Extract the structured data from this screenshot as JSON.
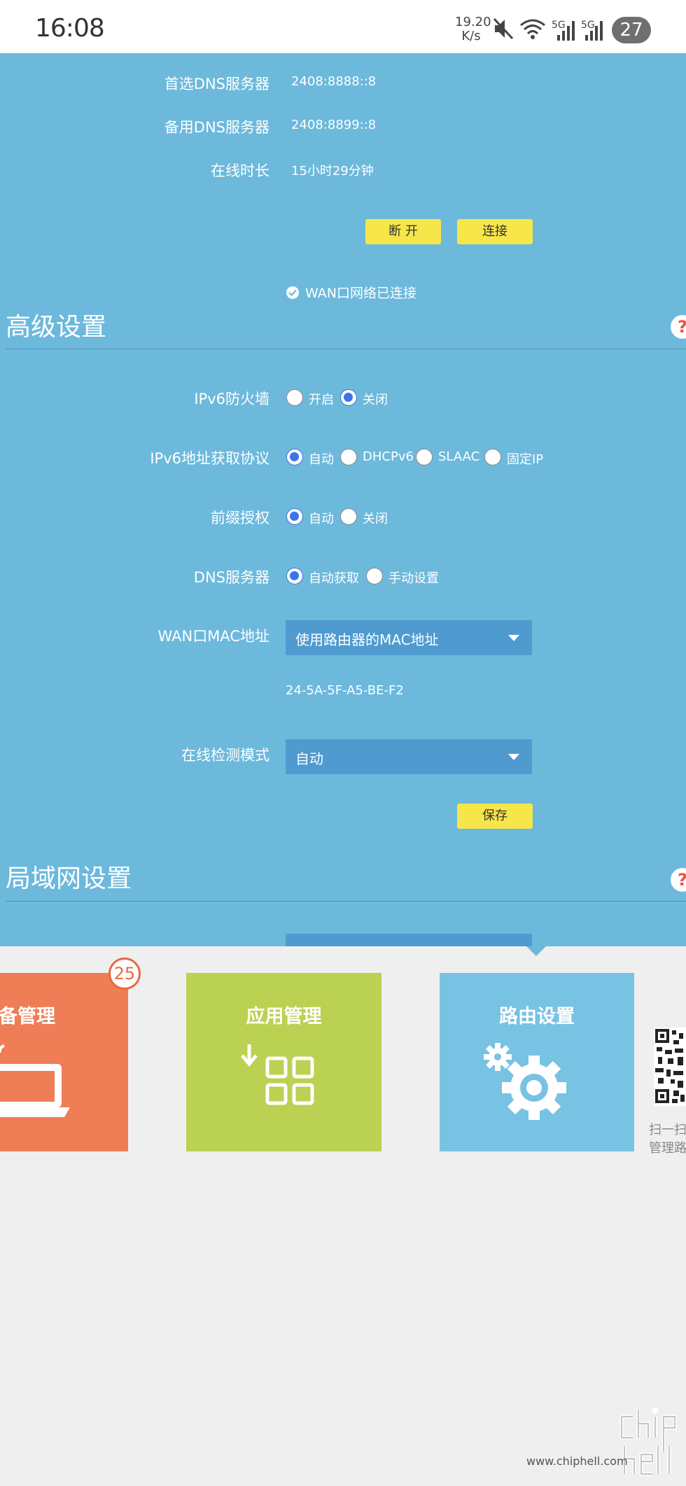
{
  "status_bar": {
    "time": "16:08",
    "net_speed_value": "19.20",
    "net_speed_unit": "K/s",
    "signal_1_label": "5G",
    "signal_2_label": "5G",
    "battery": "27",
    "icons": [
      "mute-icon",
      "wifi-icon",
      "signal-icon",
      "signal-icon",
      "battery-icon"
    ]
  },
  "wan_status": {
    "rows": [
      {
        "label": "首选DNS服务器",
        "value": "2408:8888::8"
      },
      {
        "label": "备用DNS服务器",
        "value": "2408:8899::8"
      },
      {
        "label": "在线时长",
        "value": "15小时29分钟"
      }
    ],
    "disconnect_button": "断 开",
    "connect_button": "连接",
    "status_text": "WAN口网络已连接"
  },
  "advanced": {
    "title": "高级设置",
    "help": "?",
    "firewall": {
      "label": "IPv6防火墙",
      "options": [
        "开启",
        "关闭"
      ],
      "selected": "关闭"
    },
    "protocol": {
      "label": "IPv6地址获取协议",
      "options": [
        "自动",
        "DHCPv6",
        "SLAAC",
        "固定IP"
      ],
      "selected": "自动"
    },
    "prefix": {
      "label": "前缀授权",
      "options": [
        "自动",
        "关闭"
      ],
      "selected": "自动"
    },
    "dns": {
      "label": "DNS服务器",
      "options": [
        "自动获取",
        "手动设置"
      ],
      "selected": "自动获取"
    },
    "wan_mac": {
      "label": "WAN口MAC地址",
      "selected": "使用路由器的MAC地址",
      "mac": "24-5A-5F-A5-BE-F2"
    },
    "online_detect": {
      "label": "在线检测模式",
      "selected": "自动"
    },
    "save_button": "保存"
  },
  "lan": {
    "title": "局域网设置",
    "help": "?"
  },
  "tiles": [
    {
      "title": "设备管理",
      "badge": "25",
      "color": "#ef7d55",
      "icon": "laptop-icon"
    },
    {
      "title": "应用管理",
      "color": "#bbd152",
      "icon": "apps-grid-icon"
    },
    {
      "title": "路由设置",
      "color": "#78c2e3",
      "icon": "gear-icon"
    }
  ],
  "qr": {
    "line1": "扫一扫",
    "line2": "管理路"
  },
  "watermark": {
    "url": "www.chiphell.com"
  }
}
